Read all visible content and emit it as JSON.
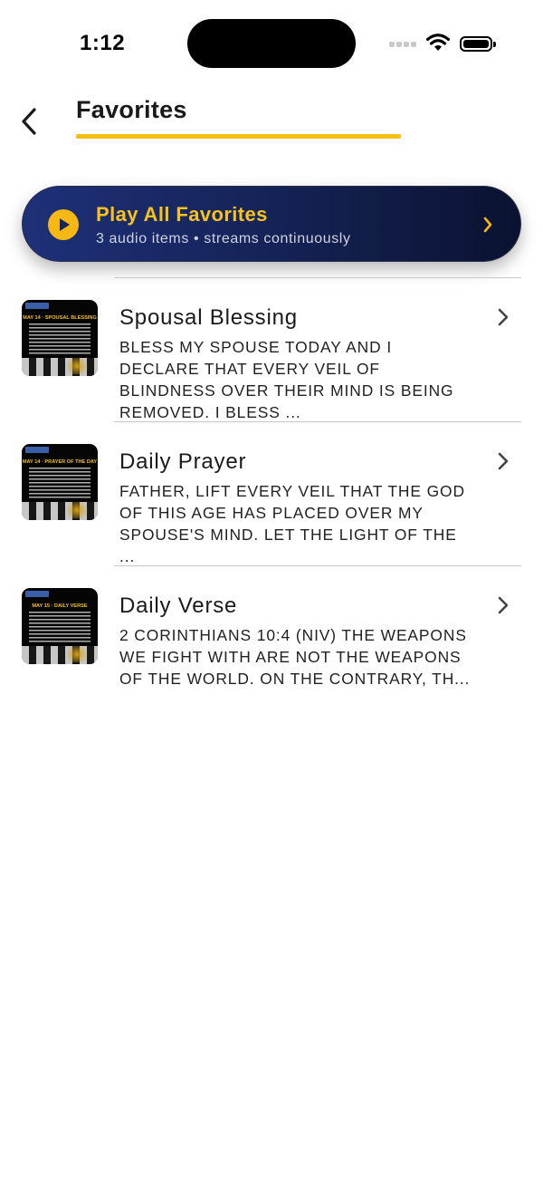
{
  "status_bar": {
    "time": "1:12",
    "icons": [
      "cellular-signal-icon",
      "wifi-icon",
      "battery-icon"
    ]
  },
  "header": {
    "back_icon": "chevron-left-icon",
    "title": "Favorites",
    "accent_color": "#f5c014"
  },
  "play_all": {
    "title": "Play All Favorites",
    "subtitle": "3 audio items • streams continuously",
    "icon": "play-icon",
    "chevron": "chevron-right-icon"
  },
  "items": [
    {
      "title": "Spousal Blessing",
      "text": "BLESS MY SPOUSE TODAY AND I DECLARE THAT EVERY VEIL OF BLINDNESS OVER THEIR MIND IS BEING REMOVED. I BLESS ...",
      "thumb_heading": "MAY 14 · SPOUSAL BLESSING"
    },
    {
      "title": "Daily Prayer",
      "text": "FATHER, LIFT EVERY VEIL THAT THE GOD OF THIS AGE HAS PLACED OVER MY SPOUSE'S MIND. LET THE LIGHT OF THE ...",
      "thumb_heading": "MAY 14 · PRAYER OF THE DAY"
    },
    {
      "title": "Daily Verse",
      "text": "2 CORINTHIANS 10:4 (NIV) THE WEAPONS WE FIGHT WITH ARE NOT THE WEAPONS OF THE WORLD. ON THE CONTRARY, TH...",
      "thumb_heading": "MAY 15 · DAILY VERSE"
    }
  ]
}
